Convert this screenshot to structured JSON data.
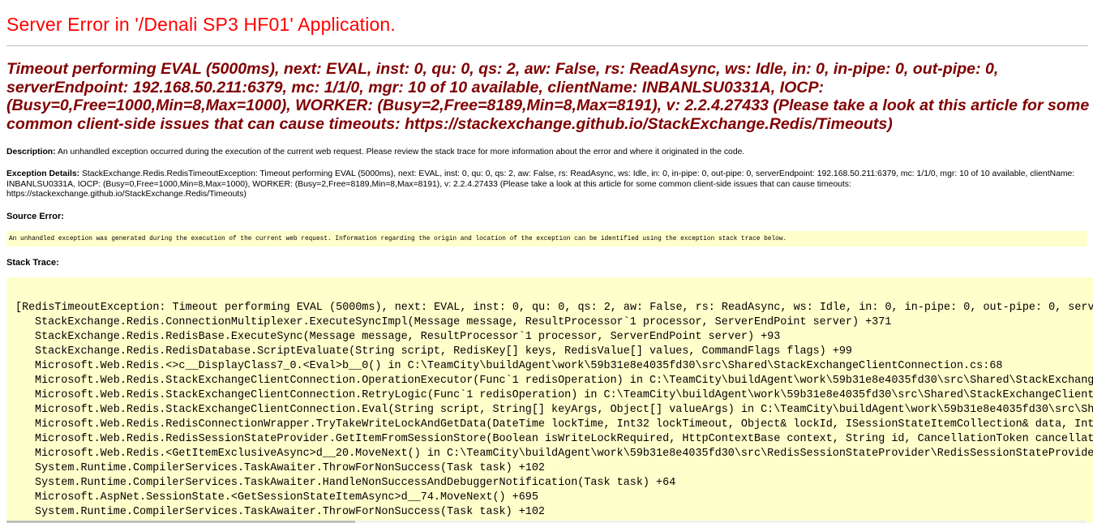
{
  "page": {
    "title": "Server Error in '/Denali SP3 HF01' Application.",
    "error_message": "Timeout performing EVAL (5000ms), next: EVAL, inst: 0, qu: 0, qs: 2, aw: False, rs: ReadAsync, ws: Idle, in: 0, in-pipe: 0, out-pipe: 0, serverEndpoint: 192.168.50.211:6379, mc: 1/1/0, mgr: 10 of 10 available, clientName: INBANLSU0331A, IOCP: (Busy=0,Free=1000,Min=8,Max=1000), WORKER: (Busy=2,Free=8189,Min=8,Max=8191), v: 2.2.4.27433 (Please take a look at this article for some common client-side issues that can cause timeouts: https://stackexchange.github.io/StackExchange.Redis/Timeouts)"
  },
  "description": {
    "label": "Description:",
    "text": " An unhandled exception occurred during the execution of the current web request. Please review the stack trace for more information about the error and where it originated in the code."
  },
  "exception_details": {
    "label": "Exception Details:",
    "text": " StackExchange.Redis.RedisTimeoutException: Timeout performing EVAL (5000ms), next: EVAL, inst: 0, qu: 0, qs: 2, aw: False, rs: ReadAsync, ws: Idle, in: 0, in-pipe: 0, out-pipe: 0, serverEndpoint: 192.168.50.211:6379, mc: 1/1/0, mgr: 10 of 10 available, clientName: INBANLSU0331A, IOCP: (Busy=0,Free=1000,Min=8,Max=1000), WORKER: (Busy=2,Free=8189,Min=8,Max=8191), v: 2.2.4.27433 (Please take a look at this article for some common client-side issues that can cause timeouts: https://stackexchange.github.io/StackExchange.Redis/Timeouts)"
  },
  "source_error": {
    "label": "Source Error:",
    "text": "An unhandled exception was generated during the execution of the current web request. Information regarding the origin and location of the exception can be identified using the exception stack trace below."
  },
  "stack_trace": {
    "label": "Stack Trace:",
    "lines": [
      "[RedisTimeoutException: Timeout performing EVAL (5000ms), next: EVAL, inst: 0, qu: 0, qs: 2, aw: False, rs: ReadAsync, ws: Idle, in: 0, in-pipe: 0, out-pipe: 0, serv",
      "StackExchange.Redis.ConnectionMultiplexer.ExecuteSyncImpl(Message message, ResultProcessor`1 processor, ServerEndPoint server) +371",
      "StackExchange.Redis.RedisBase.ExecuteSync(Message message, ResultProcessor`1 processor, ServerEndPoint server) +93",
      "StackExchange.Redis.RedisDatabase.ScriptEvaluate(String script, RedisKey[] keys, RedisValue[] values, CommandFlags flags) +99",
      "Microsoft.Web.Redis.<>c__DisplayClass7_0.<Eval>b__0() in C:\\TeamCity\\buildAgent\\work\\59b31e8e4035fd30\\src\\Shared\\StackExchangeClientConnection.cs:68",
      "Microsoft.Web.Redis.StackExchangeClientConnection.OperationExecutor(Func`1 redisOperation) in C:\\TeamCity\\buildAgent\\work\\59b31e8e4035fd30\\src\\Shared\\StackExchang",
      "Microsoft.Web.Redis.StackExchangeClientConnection.RetryLogic(Func`1 redisOperation) in C:\\TeamCity\\buildAgent\\work\\59b31e8e4035fd30\\src\\Shared\\StackExchangeClient",
      "Microsoft.Web.Redis.StackExchangeClientConnection.Eval(String script, String[] keyArgs, Object[] valueArgs) in C:\\TeamCity\\buildAgent\\work\\59b31e8e4035fd30\\src\\Sh",
      "Microsoft.Web.Redis.RedisConnectionWrapper.TryTakeWriteLockAndGetData(DateTime lockTime, Int32 lockTimeout, Object& lockId, ISessionStateItemCollection& data, Int",
      "Microsoft.Web.Redis.RedisSessionStateProvider.GetItemFromSessionStore(Boolean isWriteLockRequired, HttpContextBase context, String id, CancellationToken cancellat",
      "Microsoft.Web.Redis.<GetItemExclusiveAsync>d__20.MoveNext() in C:\\TeamCity\\buildAgent\\work\\59b31e8e4035fd30\\src\\RedisSessionStateProvider\\RedisSessionStateProvide",
      "System.Runtime.CompilerServices.TaskAwaiter.ThrowForNonSuccess(Task task) +102",
      "System.Runtime.CompilerServices.TaskAwaiter.HandleNonSuccessAndDebuggerNotification(Task task) +64",
      "Microsoft.AspNet.SessionState.<GetSessionStateItemAsync>d__74.MoveNext() +695",
      "System.Runtime.CompilerServices.TaskAwaiter.ThrowForNonSuccess(Task task) +102"
    ]
  },
  "colors": {
    "title": "#ff0000",
    "error_message": "#800000",
    "code_background": "#ffffcc",
    "rule": "#c0c0c0"
  }
}
